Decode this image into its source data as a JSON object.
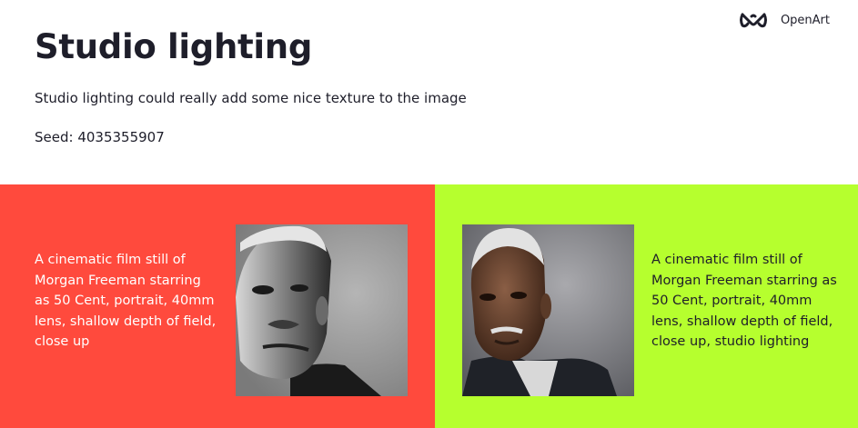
{
  "brand": {
    "logo_icon": "infinity-logo-icon",
    "name": "OpenArt"
  },
  "header": {
    "title": "Studio lighting",
    "subtitle": "Studio lighting could really add some nice texture to the image",
    "seed": "Seed: 4035355907"
  },
  "comparison": {
    "left": {
      "background_color": "#ff4a3d",
      "prompt": "A cinematic film still of Morgan Freeman starring as 50 Cent, portrait, 40mm lens, shallow depth of field, close up",
      "image_icon": "bw-portrait-image"
    },
    "right": {
      "background_color": "#b6ff2e",
      "prompt": "A cinematic film still of Morgan Freeman starring as 50 Cent, portrait, 40mm lens, shallow depth of field, close up, studio lighting",
      "image_icon": "color-portrait-image"
    }
  }
}
